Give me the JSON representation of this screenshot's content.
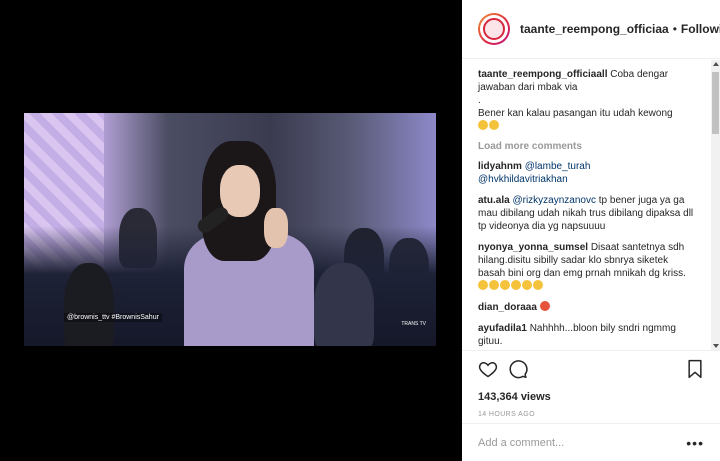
{
  "video": {
    "watermark": "@brownis_ttv  #BrownisSahur",
    "channel_logo": "TRANS TV"
  },
  "header": {
    "username": "taante_reempong_officiaa",
    "separator": "•",
    "follow_status": "Following"
  },
  "caption": {
    "username": "taante_reempong_officiaall",
    "text": "Coba dengar jawaban dari mbak via",
    "line2": ".",
    "line3": "Bener kan kalau pasangan itu udah kewong"
  },
  "load_more": "Load more comments",
  "comments": [
    {
      "username": "lidyahnm",
      "mention1": "@lambe_turah",
      "mention2": "@hvkhildavitriakhan"
    },
    {
      "username": "atu.ala",
      "mention": "@rizkyzaynzanovc",
      "text": "tp bener juga ya ga mau dibilang udah nikah trus dibilang dipaksa dll tp videonya dia yg napsuuuu"
    },
    {
      "username": "nyonya_yonna_sumsel",
      "text": "Disaat santetnya sdh hilang.disitu sibilly sadar klo sbnrya siketek basah bini org dan emg prnah mnikah dg kriss."
    },
    {
      "username": "dian_doraaa",
      "text": ""
    },
    {
      "username": "ayufadila1",
      "text": "Nahhhh...bloon bily sndri ngmmg gituu."
    }
  ],
  "actions": {
    "icons": [
      "heart-icon",
      "comment-icon",
      "bookmark-icon"
    ],
    "views": "143,364 views",
    "timestamp": "14 HOURS AGO"
  },
  "add_comment": {
    "placeholder": "Add a comment...",
    "more_label": "•••"
  },
  "colors": {
    "text": "#262626",
    "muted": "#999999",
    "mention": "#003569",
    "border": "#efefef"
  }
}
